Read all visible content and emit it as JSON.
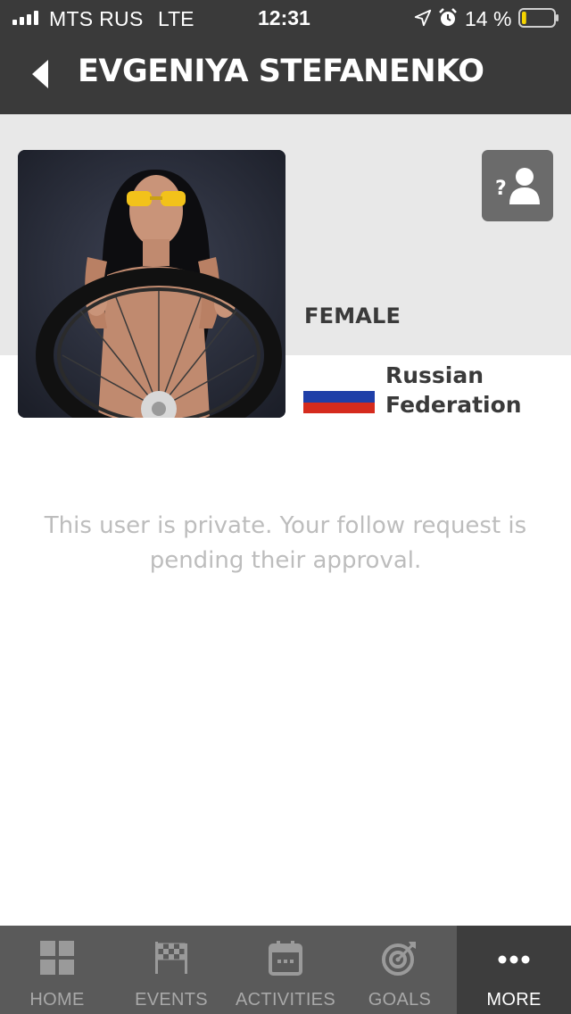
{
  "status_bar": {
    "carrier": "MTS RUS",
    "network": "LTE",
    "time": "12:31",
    "battery_percent": "14 %",
    "battery_level": 0.14,
    "battery_color": "#f5d400",
    "icons": [
      "signal-icon",
      "location-arrow-icon",
      "alarm-icon",
      "battery-icon"
    ]
  },
  "header": {
    "back_icon": "back-arrow-icon",
    "title": "EVGENIYA STEFANENKO"
  },
  "profile": {
    "avatar_alt": "profile photo",
    "unknown_user_icon": "unknown-user-icon",
    "gender": "FEMALE",
    "country_line1": "Russian",
    "country_line2": "Federation",
    "flag_colors": [
      "#ffffff",
      "#1f3fa8",
      "#d52b1e"
    ]
  },
  "main": {
    "private_message": "This user is private. Your follow request is pending their approval."
  },
  "tabs": [
    {
      "label": "HOME",
      "icon": "grid-icon",
      "active": false
    },
    {
      "label": "EVENTS",
      "icon": "checkered-flag-icon",
      "active": false
    },
    {
      "label": "ACTIVITIES",
      "icon": "calendar-icon",
      "active": false
    },
    {
      "label": "GOALS",
      "icon": "target-icon",
      "active": false
    },
    {
      "label": "MORE",
      "icon": "more-dots-icon",
      "active": true
    }
  ],
  "colors": {
    "header_bg": "#3a3a3a",
    "profile_bg": "#e8e8e8",
    "tabbar_bg": "#5a5a5a",
    "tab_active_bg": "#3d3d3d",
    "muted_text": "#bdbdbd"
  }
}
